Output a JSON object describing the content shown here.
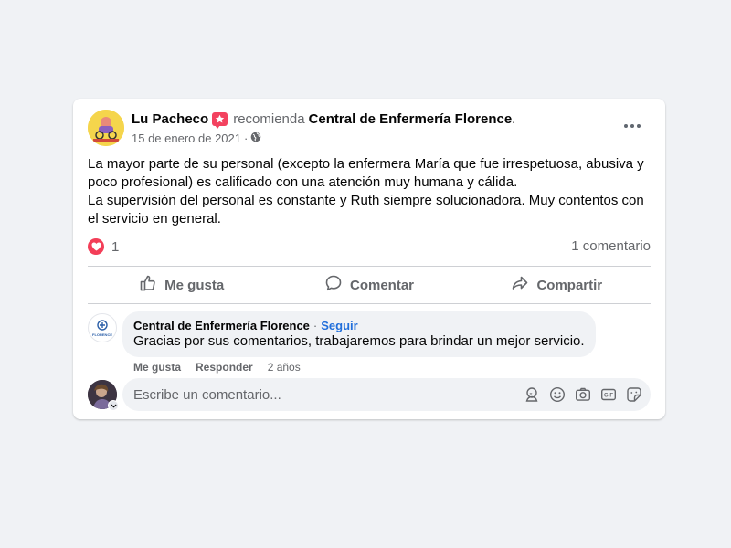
{
  "post": {
    "author": "Lu Pacheco",
    "verb": "recomienda",
    "page": "Central de Enfermería Florence",
    "page_suffix": ".",
    "date": "15 de enero de 2021",
    "date_sep": "·",
    "audience_icon": "globe-icon",
    "more_icon": "more-horizontal-icon",
    "badge_icon": "recommend-star-icon",
    "body": [
      "La mayor parte de su personal (excepto la enfermera María que fue irrespetuosa, abusiva y poco profesional) es calificado con una atención muy humana y cálida.",
      "La supervisión del personal es constante y Ruth siempre solucionadora. Muy contentos con el servicio en general."
    ]
  },
  "reactions": {
    "icon": "love-reaction-icon",
    "count": "1",
    "comments": "1 comentario"
  },
  "actions": {
    "like": "Me gusta",
    "comment": "Comentar",
    "share": "Compartir"
  },
  "comment": {
    "author": "Central de Enfermería Florence",
    "sep": "·",
    "follow": "Seguir",
    "text": "Gracias por sus comentarios, trabajaremos para brindar un mejor servicio.",
    "like": "Me gusta",
    "reply": "Responder",
    "time": "2 años",
    "avatar_text": "FLORENCE"
  },
  "composer": {
    "placeholder": "Escribe un comentario...",
    "icons": [
      "avatar-sticker-icon",
      "emoji-icon",
      "camera-icon",
      "gif-icon",
      "sticker-icon"
    ]
  },
  "colors": {
    "background": "#f0f2f5",
    "card": "#ffffff",
    "secondary_text": "#65676b",
    "link": "#216fdb",
    "love": "#f33e58",
    "recommend": "#f3425f"
  }
}
